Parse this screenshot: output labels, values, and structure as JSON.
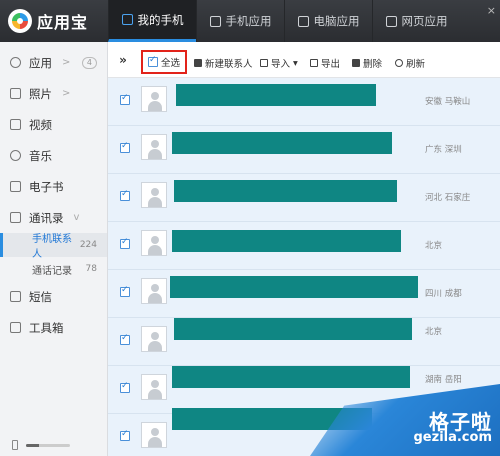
{
  "app": {
    "name": "应用宝",
    "close": "×"
  },
  "tabs": [
    {
      "label": "我的手机",
      "active": true
    },
    {
      "label": "手机应用",
      "active": false
    },
    {
      "label": "电脑应用",
      "active": false
    },
    {
      "label": "网页应用",
      "active": false
    }
  ],
  "sidebar": {
    "items": [
      {
        "label": "应用",
        "arrow": ">",
        "badge": "4"
      },
      {
        "label": "照片",
        "arrow": ">"
      },
      {
        "label": "视频"
      },
      {
        "label": "音乐"
      },
      {
        "label": "电子书"
      },
      {
        "label": "通讯录",
        "arrow": "v"
      }
    ],
    "sub_items": [
      {
        "label": "手机联系人",
        "count": "224",
        "active": true
      },
      {
        "label": "通话记录",
        "count": "78",
        "active": false
      }
    ],
    "bottom_items": [
      {
        "label": "短信"
      },
      {
        "label": "工具箱"
      }
    ],
    "storage_fill": 0.3
  },
  "toolbar": {
    "expand": "»",
    "select_all": "全选",
    "new_contact": "新建联系人",
    "import": "导入",
    "import_arrow": "▾",
    "export": "导出",
    "delete": "删除",
    "refresh": "刷新"
  },
  "contacts": [
    {
      "location": "安徽 马鞍山"
    },
    {
      "location": "广东 深圳"
    },
    {
      "location": "河北 石家庄"
    },
    {
      "location": "北京"
    },
    {
      "location": "四川 成都"
    },
    {
      "location": "北京"
    },
    {
      "location": "湖南 岳阳"
    },
    {
      "location": ""
    }
  ],
  "watermark": {
    "text": "格子啦",
    "url": "gezila.com"
  },
  "colors": {
    "accent": "#2a8de0",
    "redacted": "#0f8683",
    "highlight_border": "#e2231a"
  }
}
